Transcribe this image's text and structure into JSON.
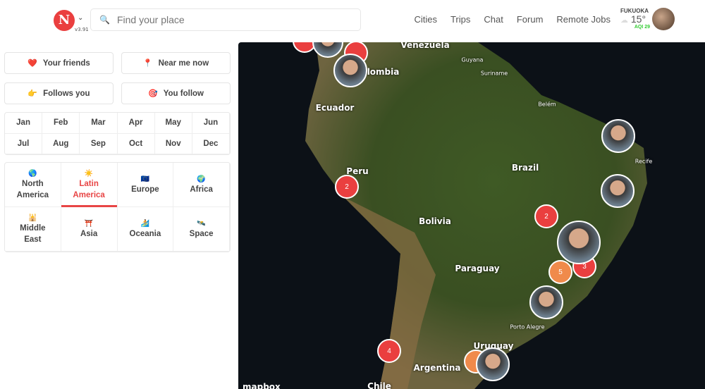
{
  "header": {
    "logo_text": "N",
    "version": "v3.91",
    "search_placeholder": "Find your place",
    "nav": [
      "Cities",
      "Trips",
      "Chat",
      "Forum",
      "Remote Jobs"
    ],
    "weather": {
      "city": "FUKUOKA",
      "icon": "☁",
      "temp": "15°",
      "aqi": "AQI 29"
    }
  },
  "filters": [
    {
      "emoji": "❤️",
      "label": "Your friends"
    },
    {
      "emoji": "📍",
      "label": "Near me now"
    },
    {
      "emoji": "👉",
      "label": "Follows you"
    },
    {
      "emoji": "🎯",
      "label": "You follow"
    }
  ],
  "months": [
    "Jan",
    "Feb",
    "Mar",
    "Apr",
    "May",
    "Jun",
    "Jul",
    "Aug",
    "Sep",
    "Oct",
    "Nov",
    "Dec"
  ],
  "regions": [
    {
      "emoji": "🌎",
      "label": "North America"
    },
    {
      "emoji": "☀️",
      "label": "Latin America",
      "active": true
    },
    {
      "emoji": "🇪🇺",
      "label": "Europe"
    },
    {
      "emoji": "🌍",
      "label": "Africa"
    },
    {
      "emoji": "🕌",
      "label": "Middle East"
    },
    {
      "emoji": "⛩️",
      "label": "Asia"
    },
    {
      "emoji": "🏄",
      "label": "Oceania"
    },
    {
      "emoji": "🛰️",
      "label": "Space"
    }
  ],
  "map": {
    "labels": [
      "Venezuela",
      "Guyana",
      "Suriname",
      "Colombia",
      "Ecuador",
      "Belém",
      "Brazil",
      "Recife",
      "Peru",
      "Bolivia",
      "Paraguay",
      "Porto Alegre",
      "Uruguay",
      "Argentina",
      "Chile"
    ],
    "clusters": [
      "2",
      "2",
      "3",
      "5",
      "4"
    ],
    "attribution": "mapbox"
  }
}
